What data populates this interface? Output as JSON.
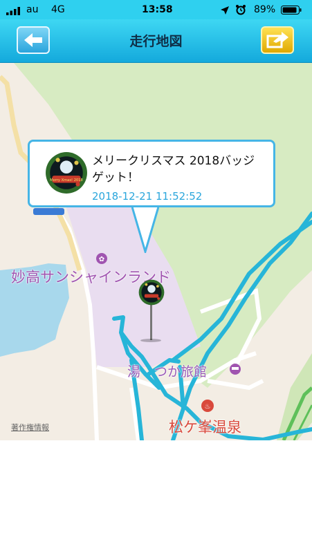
{
  "status_bar": {
    "carrier": "au",
    "network": "4G",
    "time": "13:58",
    "battery": "89%",
    "icons": [
      "signal-bars-icon",
      "location-arrow-icon",
      "alarm-clock-icon",
      "battery-icon"
    ]
  },
  "nav": {
    "title": "走行地図",
    "back_icon": "arrow-left-icon",
    "share_icon": "share-arrow-icon"
  },
  "map": {
    "labels": {
      "sunshine_land": "妙高サンシャインランド",
      "inn_prefix": "湯",
      "inn_suffix": "つか旅館",
      "onsen": "松ケ峯温泉",
      "copyright": "著作権情報"
    },
    "colors": {
      "route": "#27b5d8",
      "water": "#a8d8ec",
      "park": "#e9ddf0",
      "green": "#d7ebc2",
      "poi_purple": "#a054b0",
      "poi_red": "#d9493c"
    }
  },
  "callout": {
    "title": "メリークリスマス 2018バッジゲット！",
    "timestamp": "2018-12-21 11:52:52",
    "badge_text": "Merry Xmas! 2018"
  }
}
